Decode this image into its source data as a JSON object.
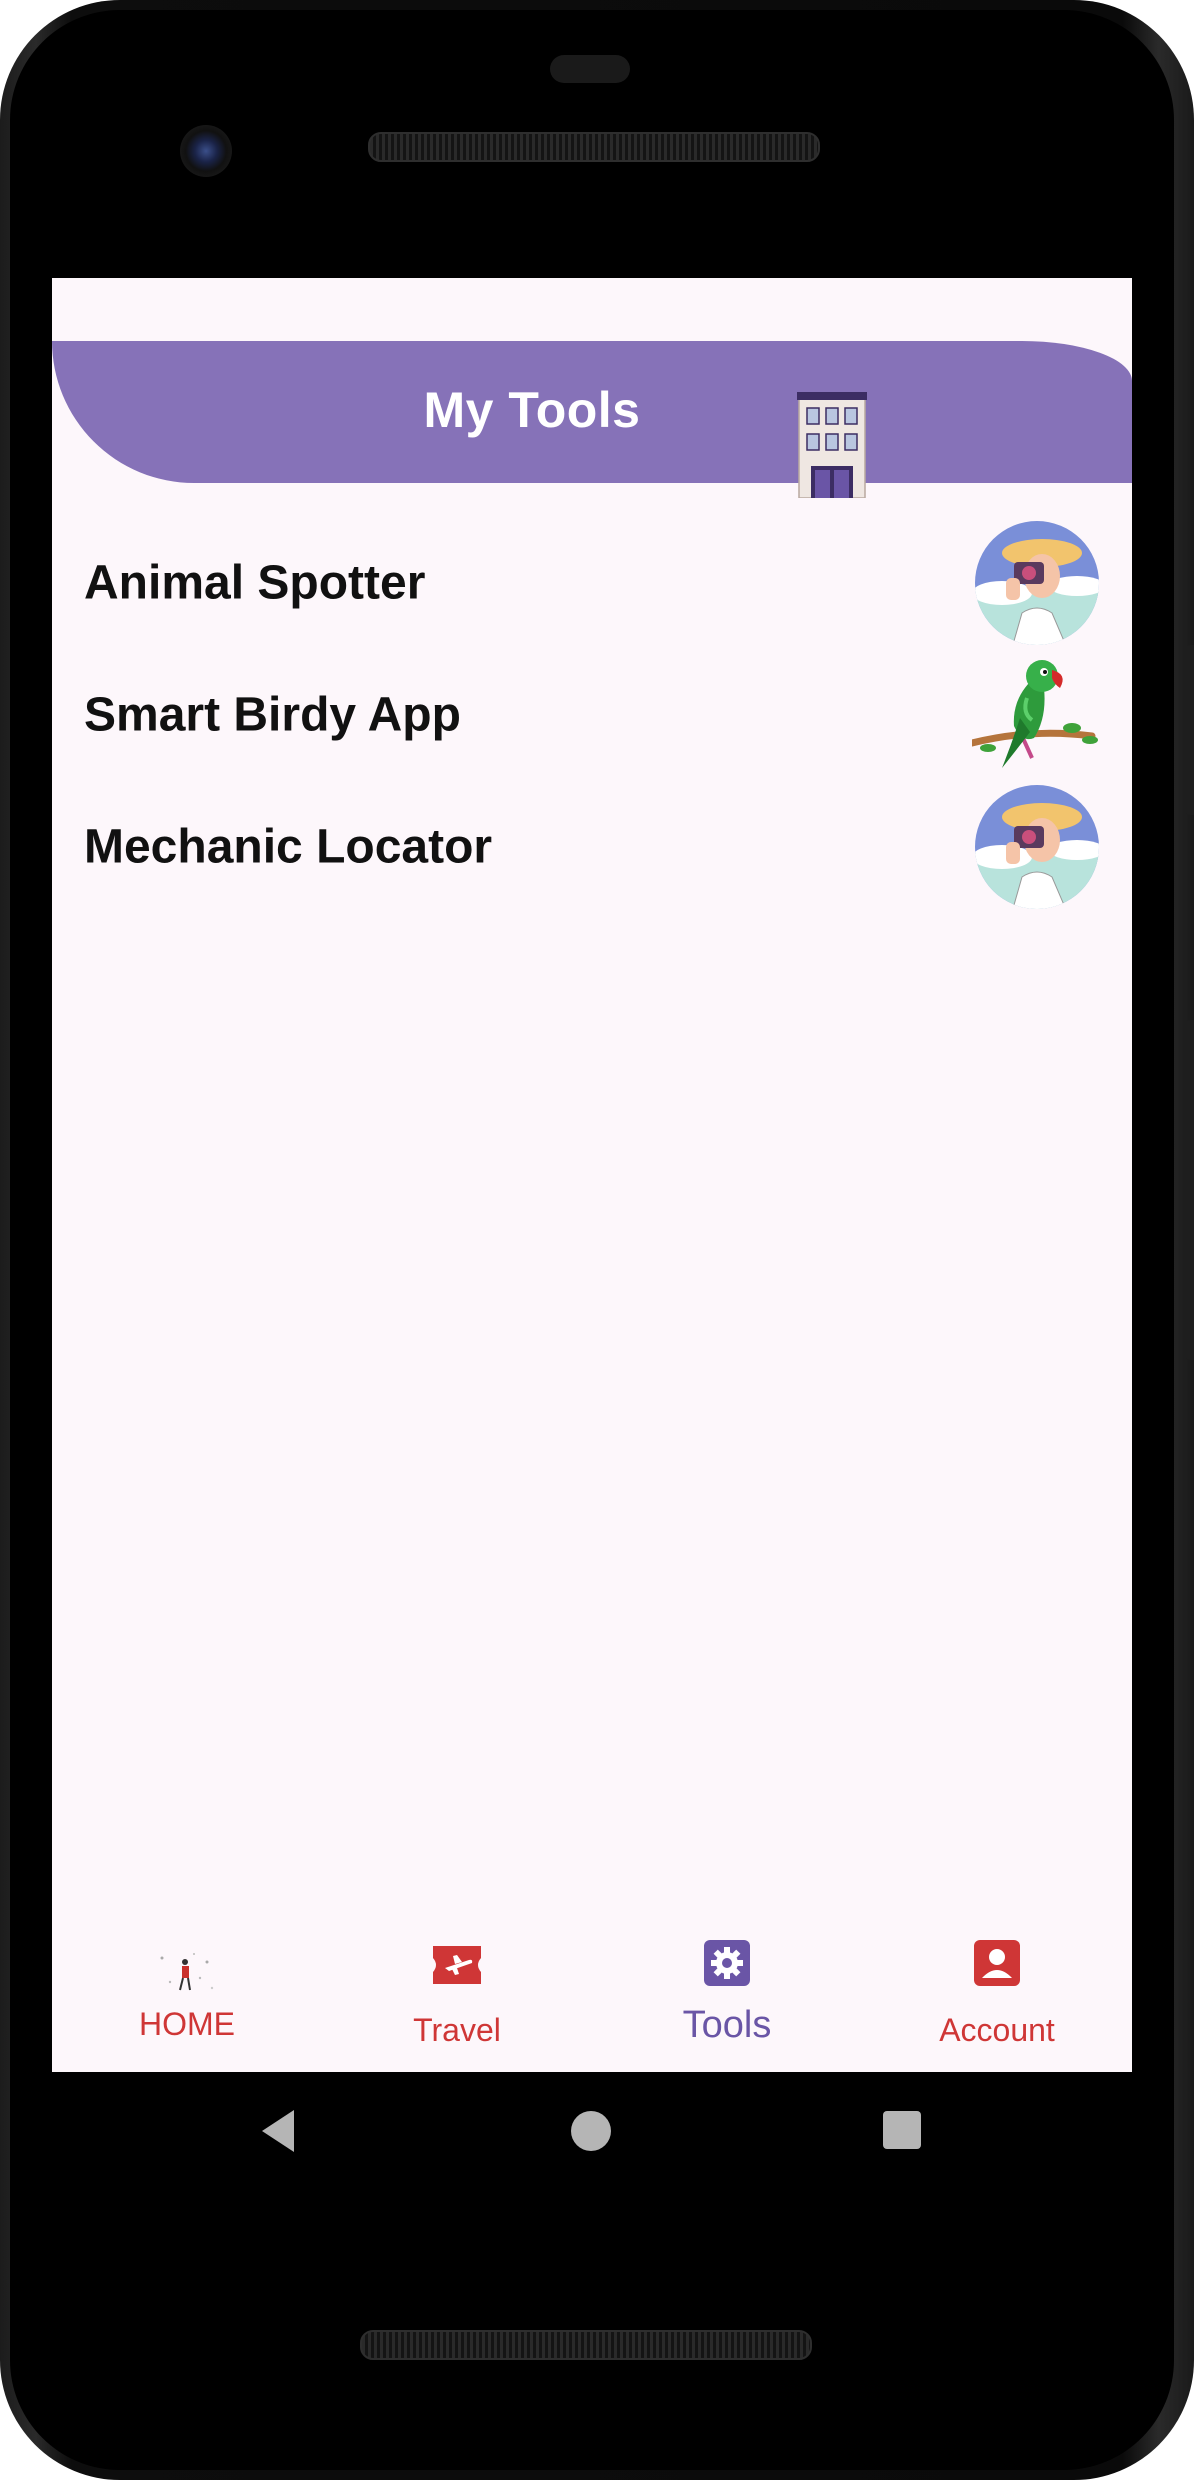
{
  "header": {
    "title": "My Tools"
  },
  "tools": [
    {
      "label": "Animal Spotter",
      "thumb": "photographer-avatar"
    },
    {
      "label": "Smart Birdy App",
      "thumb": "parrot-illustration"
    },
    {
      "label": "Mechanic Locator",
      "thumb": "photographer-avatar"
    }
  ],
  "bottom_nav": {
    "items": [
      {
        "label": "HOME",
        "icon": "traveler-icon",
        "active": false
      },
      {
        "label": "Travel",
        "icon": "plane-ticket-icon",
        "active": false
      },
      {
        "label": "Tools",
        "icon": "gear-icon",
        "active": true
      },
      {
        "label": "Account",
        "icon": "account-icon",
        "active": false
      }
    ]
  },
  "colors": {
    "header_bg": "#8672b8",
    "active_nav": "#6a55a6",
    "inactive_nav": "#cf3636",
    "screen_bg": "#fdf7fb"
  }
}
